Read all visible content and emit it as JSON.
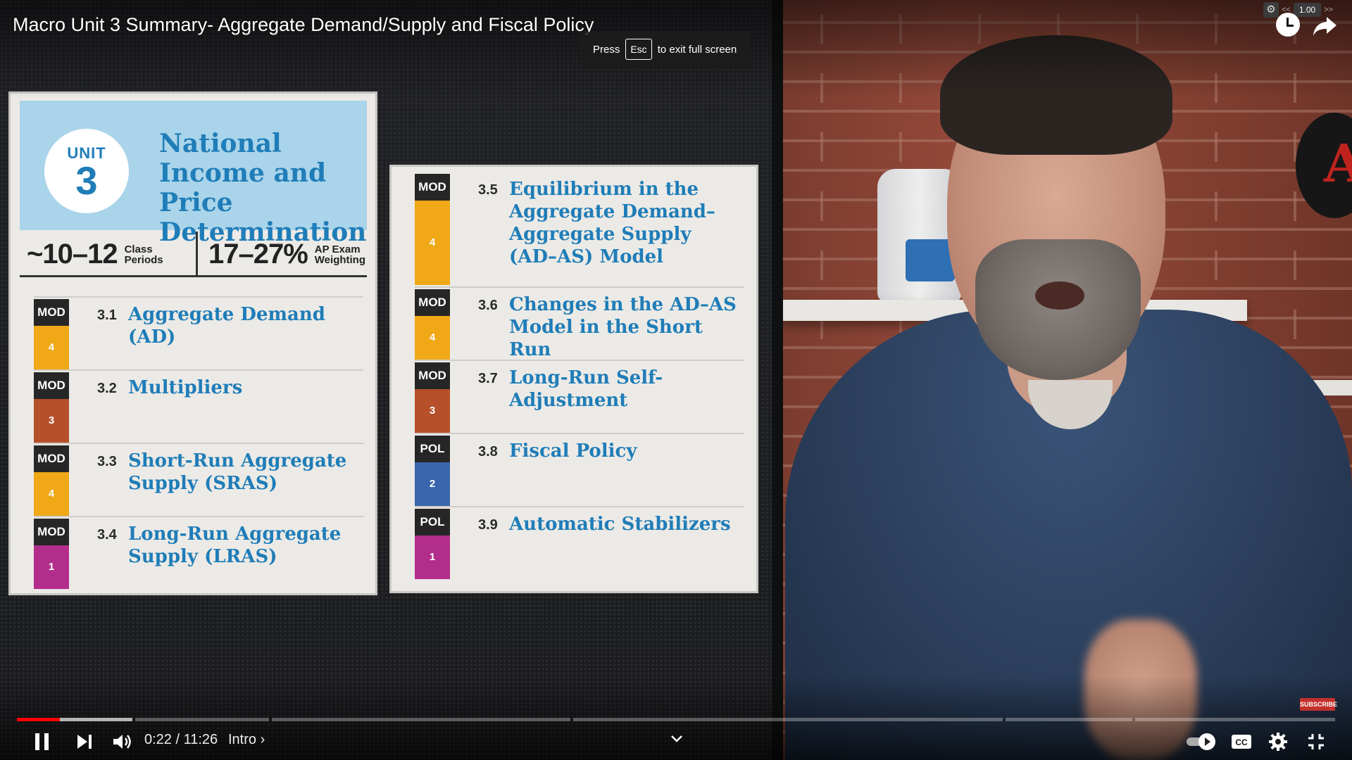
{
  "video": {
    "title": "Macro Unit 3 Summary- Aggregate Demand/Supply and Fiscal Policy",
    "esc_tip": {
      "prefix": "Press",
      "key": "Esc",
      "suffix": "to exit full screen"
    },
    "speed": "1.00",
    "speed_prev": "<<",
    "speed_next": ">>",
    "subscribe_label": "SUBSCRIBE"
  },
  "slide": {
    "unit_word": "UNIT",
    "unit_number": "3",
    "unit_title": "National Income and Price Determination",
    "class_periods": "~10–12",
    "class_periods_label": "Class\nPeriods",
    "exam_weighting": "17–27%",
    "exam_weighting_label": "AP Exam\nWeighting",
    "topics_left": [
      {
        "badge": "MOD",
        "level": "4",
        "color": "#f0a817",
        "num": "3.1",
        "title": "Aggregate Demand (AD)"
      },
      {
        "badge": "MOD",
        "level": "3",
        "color": "#b5502a",
        "num": "3.2",
        "title": "Multipliers"
      },
      {
        "badge": "MOD",
        "level": "4",
        "color": "#f0a817",
        "num": "3.3",
        "title": "Short-Run Aggregate Supply (SRAS)"
      },
      {
        "badge": "MOD",
        "level": "1",
        "color": "#b32e8c",
        "num": "3.4",
        "title": "Long-Run Aggregate Supply (LRAS)"
      }
    ],
    "topics_right": [
      {
        "badge": "MOD",
        "level": "4",
        "color": "#f0a817",
        "num": "3.5",
        "title": "Equilibrium in the Aggregate Demand–Aggregate Supply (AD–AS) Model"
      },
      {
        "badge": "MOD",
        "level": "4",
        "color": "#f0a817",
        "num": "3.6",
        "title": "Changes in the AD–AS Model in the Short Run"
      },
      {
        "badge": "MOD",
        "level": "3",
        "color": "#b5502a",
        "num": "3.7",
        "title": "Long-Run Self-Adjustment"
      },
      {
        "badge": "POL",
        "level": "2",
        "color": "#3966ad",
        "num": "3.8",
        "title": "Fiscal Policy"
      },
      {
        "badge": "POL",
        "level": "1",
        "color": "#b32e8c",
        "num": "3.9",
        "title": "Automatic Stabilizers"
      }
    ]
  },
  "player": {
    "current_time": "0:22",
    "duration": "11:26",
    "time_display": "0:22 / 11:26",
    "chapter": "Intro ›",
    "played_fraction": 0.0325,
    "cc_label": "CC",
    "colors": {
      "played": "#ff0000",
      "accent": "#ffffff"
    }
  }
}
